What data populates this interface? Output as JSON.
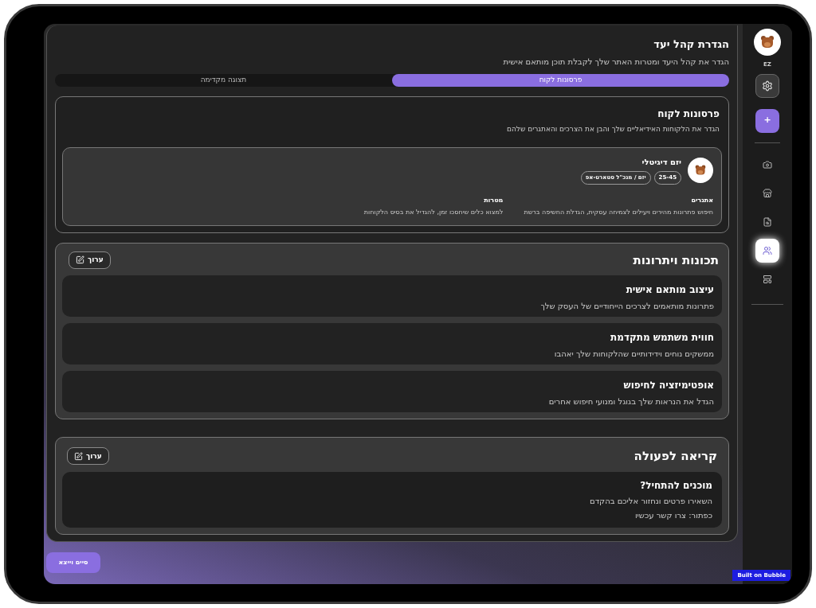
{
  "header": {
    "title": "הגדרת קהל יעד",
    "subtitle": "הגדר את קהל היעד ומטרות האתר שלך לקבלת תוכן מותאם אישית"
  },
  "tabs": [
    {
      "label": "פרסונות לקוח",
      "selected": true
    },
    {
      "label": "תצוגה מקדימה",
      "selected": false
    }
  ],
  "user": {
    "initials": "EZ"
  },
  "sidebar": {
    "add_label": "+",
    "items": [
      {
        "kind": "camera",
        "selected": false
      },
      {
        "kind": "store",
        "selected": false
      },
      {
        "kind": "search-file",
        "selected": false
      },
      {
        "kind": "users",
        "selected": true
      },
      {
        "kind": "layout",
        "selected": false
      }
    ]
  },
  "personas": {
    "title": "פרסונות לקוח",
    "subtitle": "הגדר את הלקוחות האידיאליים שלך והבן את הצרכים והאתגרים שלהם",
    "items": [
      {
        "name": "יזם דיגיטלי",
        "tags": [
          "25-45",
          "יזם / מנכ\"ל סטארט-אפ"
        ],
        "fields": [
          {
            "label": "אתגרים",
            "text": "חיפוש פתרונות מהירים ויעילים לצמיחה עסקית, הגדלת החשיפה ברשת"
          },
          {
            "label": "מטרות",
            "text": "למצוא כלים שיחסכו זמן, להגדיל את בסיס הלקוחות"
          }
        ]
      }
    ]
  },
  "features": {
    "title": "תכונות ויתרונות",
    "edit_label": "ערוך",
    "items": [
      {
        "title": "עיצוב מותאם אישית",
        "text": "פתרונות מותאמים לצרכים הייחודיים של העסק שלך"
      },
      {
        "title": "חווית משתמש מתקדמת",
        "text": "ממשקים נוחים וידידותיים שהלקוחות שלך יאהבו"
      },
      {
        "title": "אופטימיזציה לחיפוש",
        "text": "הגדל את הנראות שלך בגוגל ומנועי חיפוש אחרים"
      }
    ]
  },
  "cta": {
    "title": "קריאה לפעולה",
    "edit_label": "ערוך",
    "card_title": "מוכנים להתחיל?",
    "lines": [
      "השאירו פרטים ונחזור אליכם בהקדם",
      "כפתור: צרו קשר עכשיו"
    ]
  },
  "finish_button": "סיים וייצא",
  "badge": "Built on Bubble"
}
